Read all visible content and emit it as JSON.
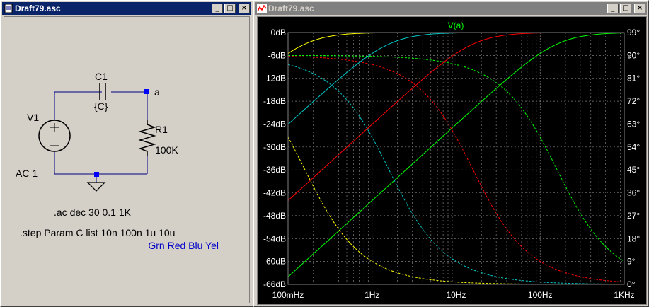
{
  "schematic_window": {
    "title": "Draft79.asc",
    "labels": {
      "c1_name": "C1",
      "c1_value": "{C}",
      "node_label": "a",
      "v1_name": "V1",
      "v1_value": "AC 1",
      "r1_name": "R1",
      "r1_value": "100K",
      "directive_ac": ".ac dec 30 0.1 1K",
      "directive_step": ".step Param C list 10n 100n 1u 10u",
      "color_note": "Grn Red Blu Yel"
    }
  },
  "plot_window": {
    "title": "Draft79.asc",
    "trace_label": "V(a)"
  },
  "chart_data": {
    "type": "line",
    "title": "V(a)",
    "x_scale": "log",
    "xlim": [
      0.1,
      1000
    ],
    "x_ticks": [
      "100mHz",
      "1Hz",
      "10Hz",
      "100Hz",
      "1KHz"
    ],
    "ylim_db": [
      -66,
      0
    ],
    "y_left_ticks": [
      "0dB",
      "-6dB",
      "-12dB",
      "-18dB",
      "-24dB",
      "-30dB",
      "-36dB",
      "-42dB",
      "-48dB",
      "-54dB",
      "-60dB",
      "-66dB"
    ],
    "ylim_phase_deg": [
      0,
      99
    ],
    "y_right_ticks": [
      "99°",
      "90°",
      "81°",
      "72°",
      "63°",
      "54°",
      "45°",
      "36°",
      "27°",
      "18°",
      "9°",
      "0°"
    ],
    "grid": true,
    "series": [
      {
        "step": "10n",
        "color": "#00ff00",
        "corner_hz": 159.15
      },
      {
        "step": "100n",
        "color": "#ff0000",
        "corner_hz": 15.915
      },
      {
        "step": "1u",
        "color": "#00c8c8",
        "corner_hz": 1.5915
      },
      {
        "step": "10u",
        "color": "#ffff00",
        "corner_hz": 0.15915
      }
    ]
  }
}
